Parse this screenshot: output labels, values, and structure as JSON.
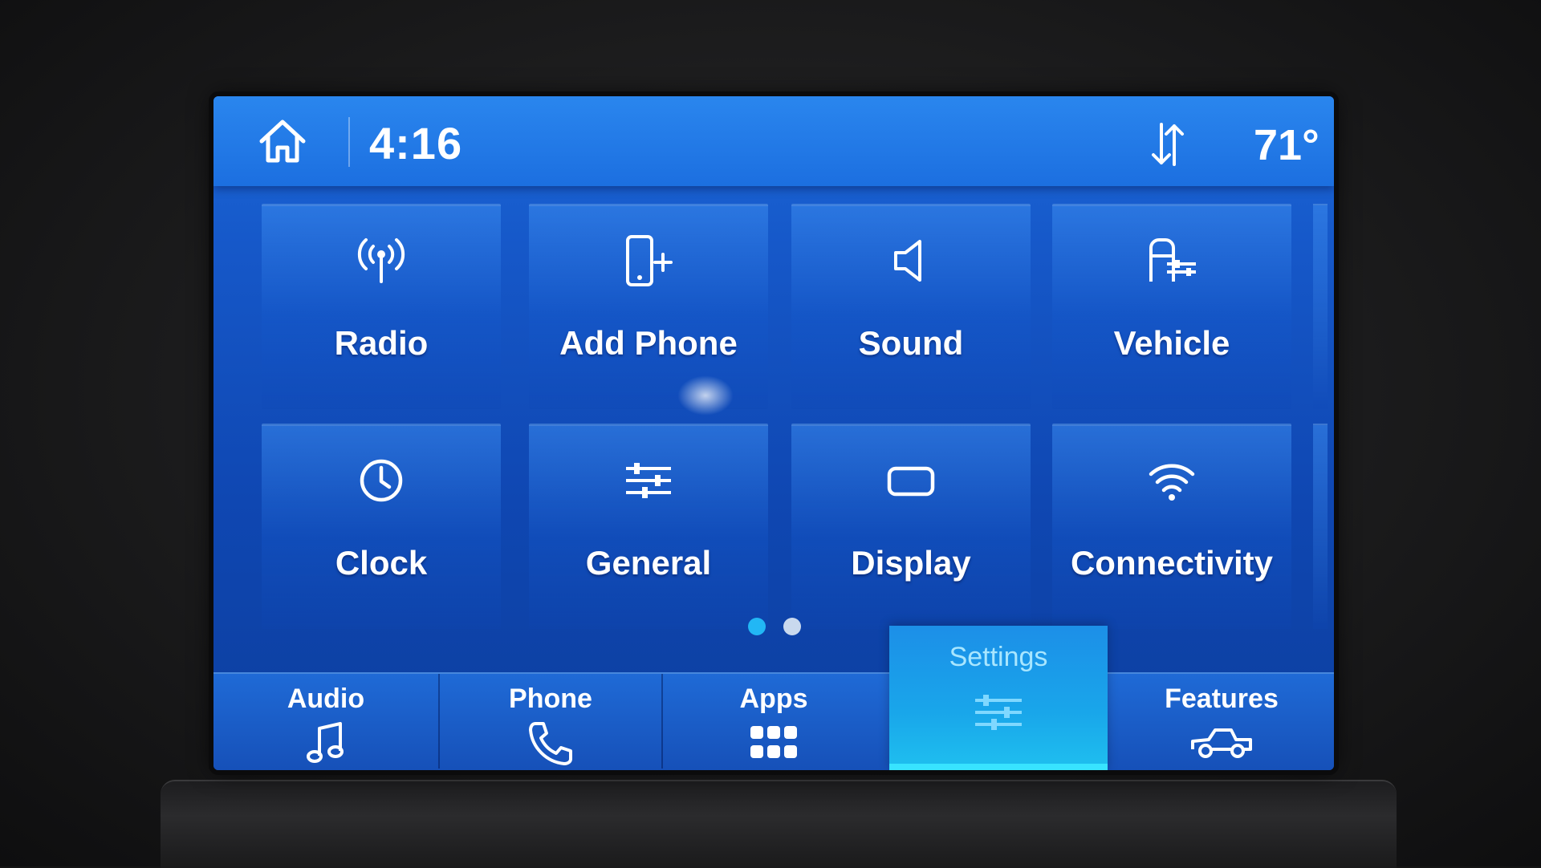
{
  "status_bar": {
    "time": "4:16",
    "temperature": "71°",
    "home_icon": "home-icon",
    "sort_icon": "sort-arrows-icon"
  },
  "tiles": [
    {
      "label": "Radio",
      "icon": "radio-antenna-icon"
    },
    {
      "label": "Add Phone",
      "icon": "add-phone-icon"
    },
    {
      "label": "Sound",
      "icon": "speaker-icon"
    },
    {
      "label": "Vehicle",
      "icon": "vehicle-settings-icon"
    },
    {
      "label": "Clock",
      "icon": "clock-icon"
    },
    {
      "label": "General",
      "icon": "sliders-icon"
    },
    {
      "label": "Display",
      "icon": "display-icon"
    },
    {
      "label": "Connectivity",
      "icon": "wifi-icon"
    }
  ],
  "pager": {
    "pages": 2,
    "current": 1
  },
  "bottom_nav": [
    {
      "label": "Audio",
      "icon": "music-note-icon",
      "active": false
    },
    {
      "label": "Phone",
      "icon": "phone-icon",
      "active": false
    },
    {
      "label": "Apps",
      "icon": "apps-grid-icon",
      "active": false
    },
    {
      "label": "Settings",
      "icon": "settings-sliders-icon",
      "active": true
    },
    {
      "label": "Features",
      "icon": "truck-icon",
      "active": false
    }
  ],
  "colors": {
    "accent_active": "#38e3ff",
    "pager_active": "#22b7f5",
    "screen_blue": "#1658c9"
  }
}
